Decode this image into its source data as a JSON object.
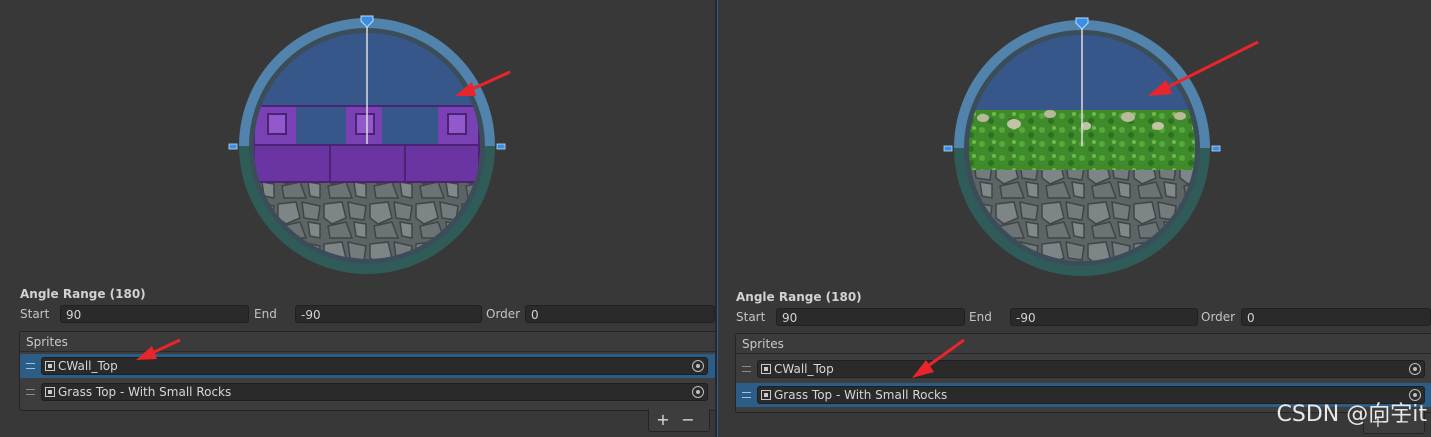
{
  "panels": [
    {
      "angle_range_label": "Angle Range (180)",
      "start_label": "Start",
      "start_value": "90",
      "end_label": "End",
      "end_value": "-90",
      "order_label": "Order",
      "order_value": "0",
      "sprites_header": "Sprites",
      "sprites": [
        {
          "name": "CWall_Top",
          "selected": true
        },
        {
          "name": "Grass Top - With Small Rocks",
          "selected": false
        }
      ],
      "add_label": "+",
      "remove_label": "−",
      "preview_sprite": "castle-wall"
    },
    {
      "angle_range_label": "Angle Range (180)",
      "start_label": "Start",
      "start_value": "90",
      "end_label": "End",
      "end_value": "-90",
      "order_label": "Order",
      "order_value": "0",
      "sprites_header": "Sprites",
      "sprites": [
        {
          "name": "CWall_Top",
          "selected": false
        },
        {
          "name": "Grass Top - With Small Rocks",
          "selected": true
        }
      ],
      "add_label": "+",
      "remove_label": "−",
      "preview_sprite": "grass-rocks"
    }
  ],
  "watermark": "CSDN @向宇it",
  "colors": {
    "selection": "#2c5d87",
    "annotation_arrow": "#e8252a",
    "handle": "#3a8ee6"
  }
}
